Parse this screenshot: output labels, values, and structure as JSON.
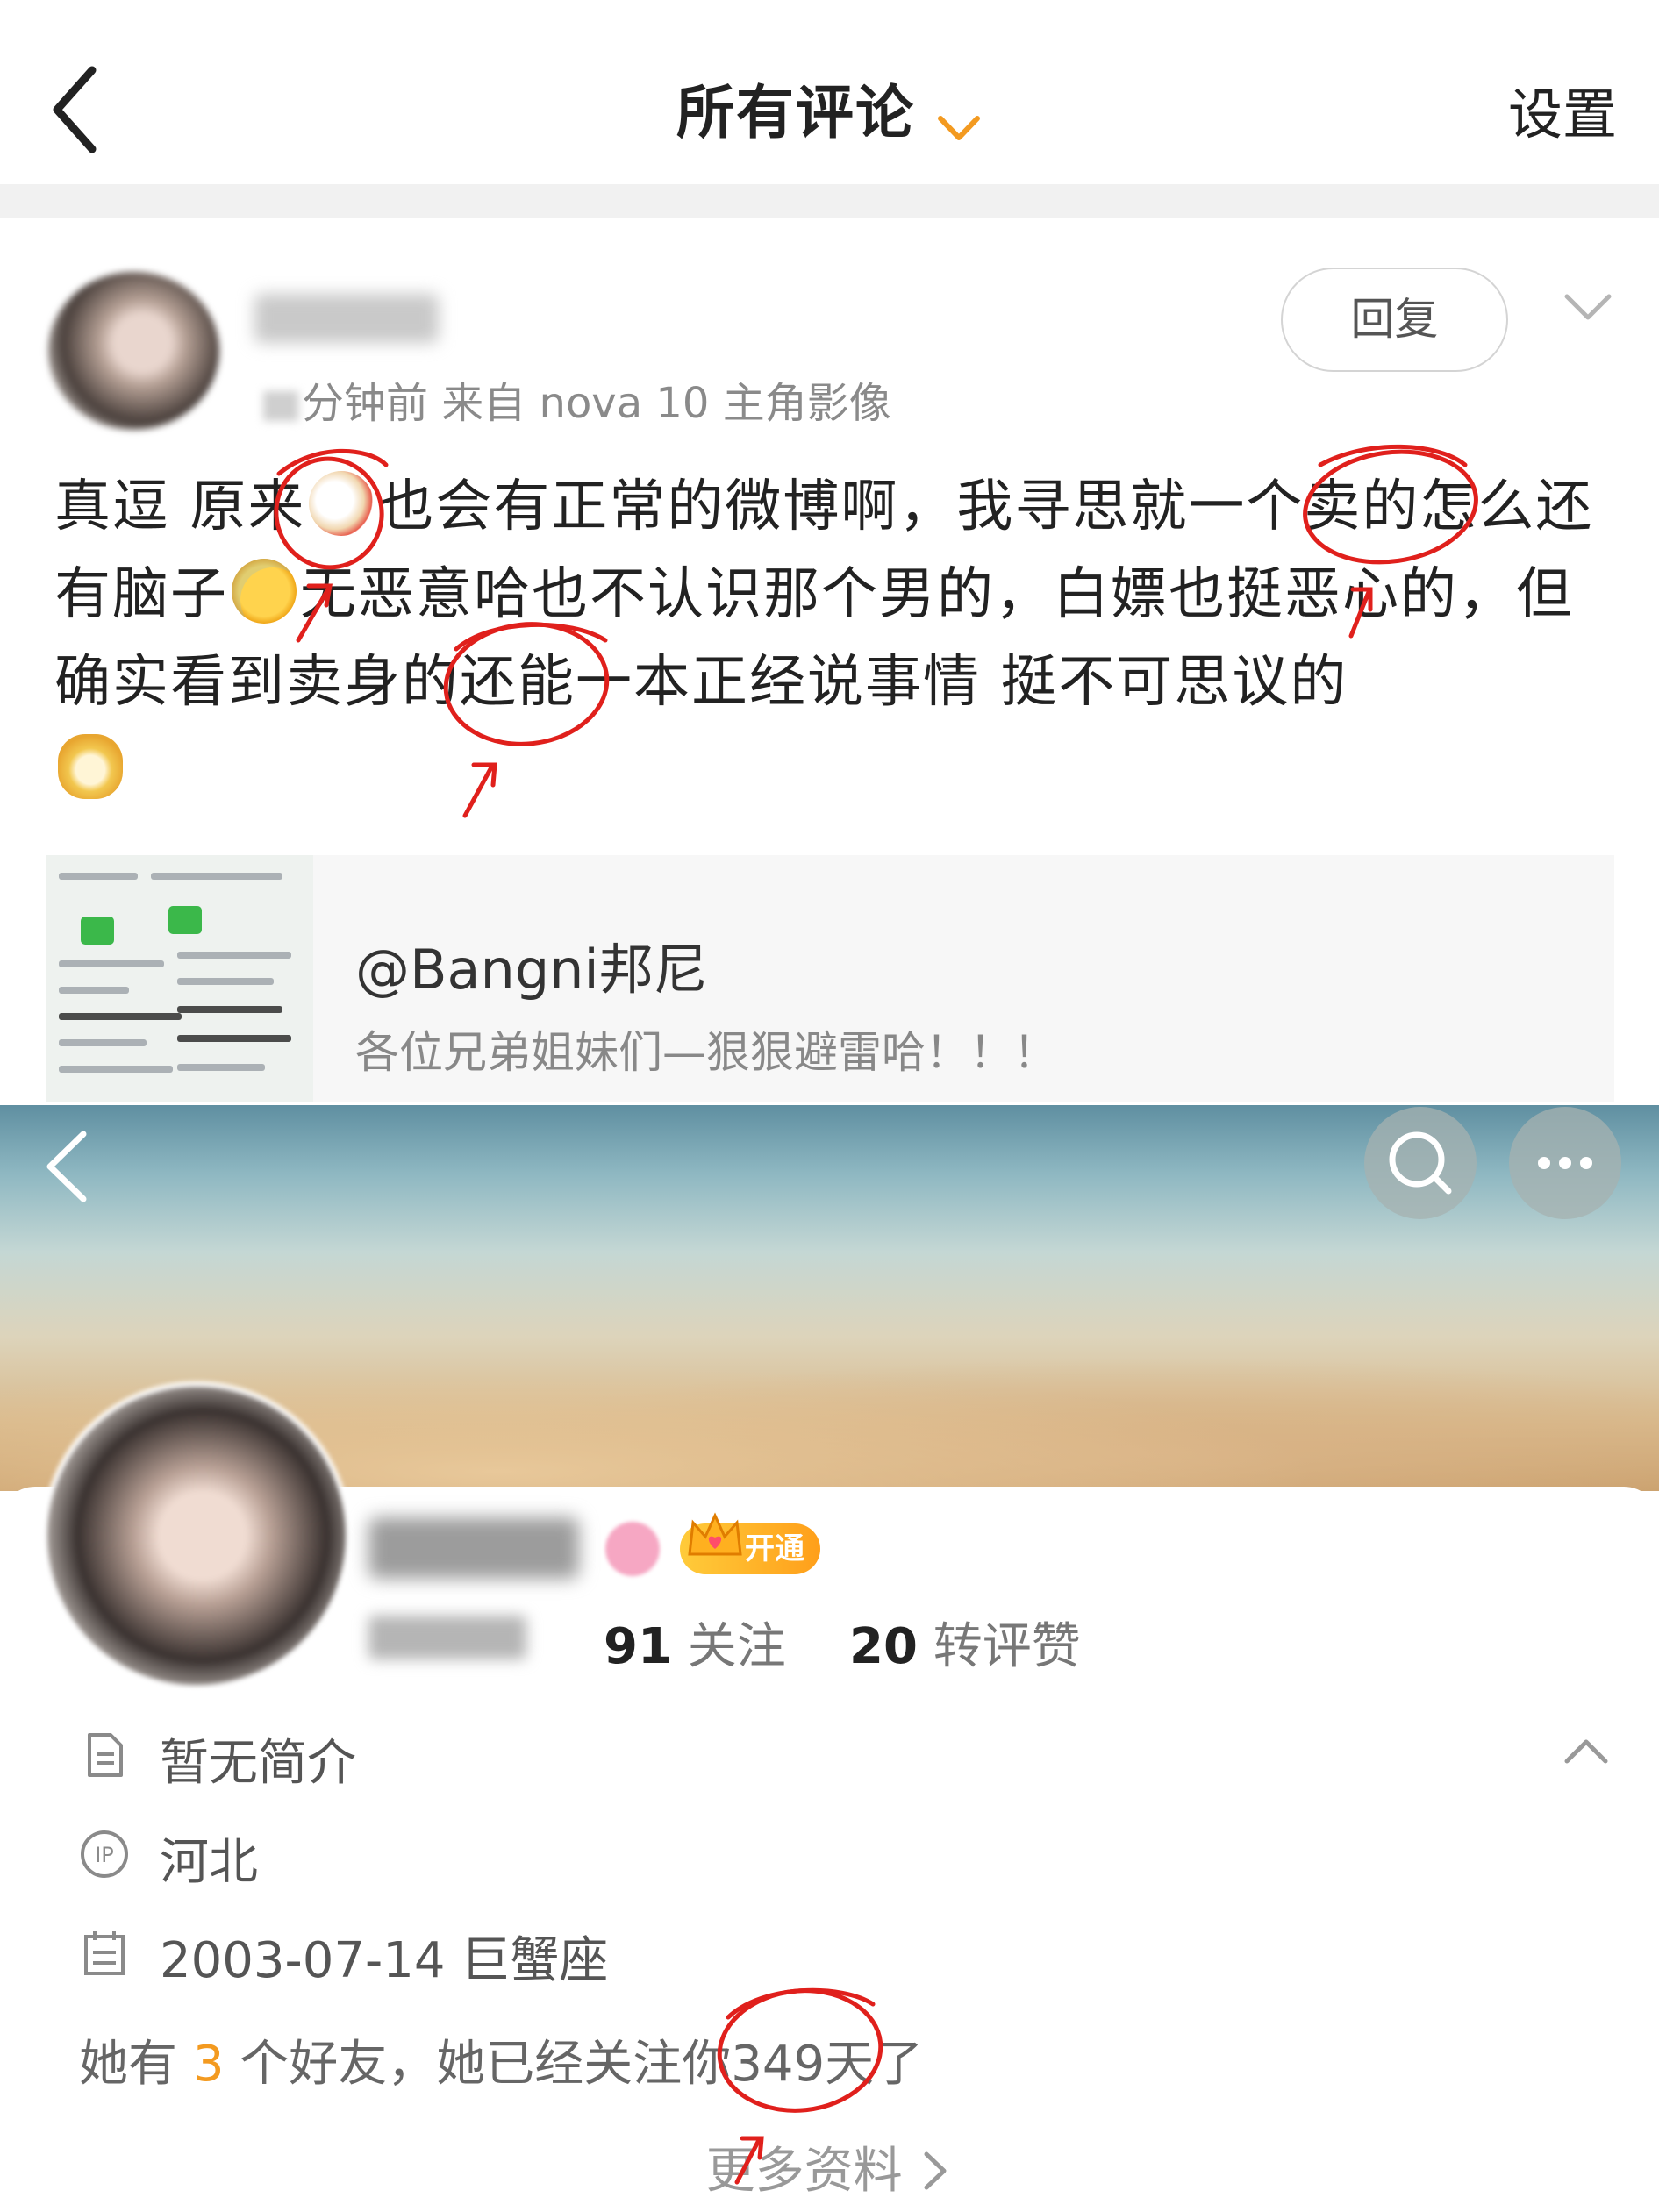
{
  "comment_screen": {
    "header": {
      "title": "所有评论",
      "settings_label": "设置"
    },
    "comment": {
      "meta": "分钟前  来自 nova 10 主角影像",
      "reply_label": "回复",
      "text_1": "真逗 原来",
      "emoji_1": "chicken",
      "text_2": "也会有正常的微博啊，我寻思就一个卖的怎么还有脑子",
      "emoji_2": "crying-face",
      "text_3": "无恶意哈也不认识那个男的，白嫖也挺恶心的，但确实看到卖身的还能一本正经说事情  挺不可思议的",
      "emoji_3": "doge"
    },
    "shared_post": {
      "name": "@Bangni邦尼",
      "description": "各位兄弟姐妹们—狠狠避雷哈！！！"
    }
  },
  "profile_screen": {
    "vip_label": "开通",
    "stats": [
      {
        "value": "91",
        "label": "关注"
      },
      {
        "value": "20",
        "label": "转评赞"
      }
    ],
    "bio": "暂无简介",
    "ip_location": "河北",
    "birthday": "2003-07-14 巨蟹座",
    "friends_text_prefix": "她有",
    "friends_count": "3",
    "friends_text_suffix": "个好友，她已经关注你349天了",
    "more_info_label": "更多资料"
  },
  "colors": {
    "accent": "#f39a20",
    "annotation_red": "#e0201c",
    "gray_text": "#888888"
  }
}
